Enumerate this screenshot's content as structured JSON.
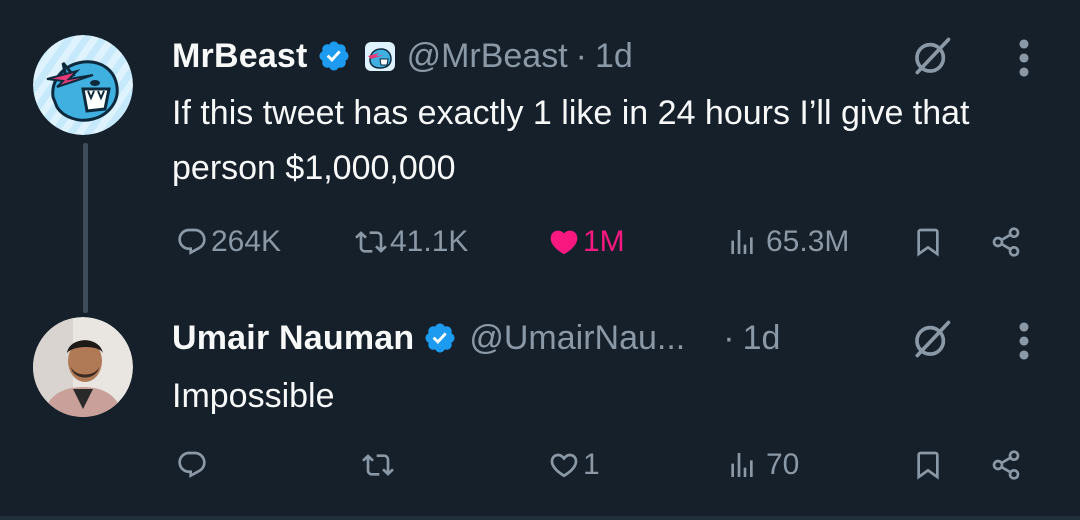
{
  "colors": {
    "background": "#15202b",
    "text_primary": "#f7f9f9",
    "text_secondary": "#8b98a5",
    "verified_blue": "#1d9bf0",
    "like_pink": "#f91880"
  },
  "tweets": [
    {
      "author": {
        "name": "MrBeast",
        "handle": "@MrBeast",
        "verified": true,
        "avatar": "mrbeast-panther-logo-avatar",
        "badge": "mrbeast-affiliate-logo"
      },
      "separator": "·",
      "time": "1d",
      "text": "If this tweet has exactly 1 like in 24 hours I’ll give that person $1,000,000",
      "actions": {
        "replies": "264K",
        "reposts": "41.1K",
        "likes": "1M",
        "liked": true,
        "views": "65.3M"
      },
      "icons": [
        "grok-icon",
        "more-icon",
        "reply-icon",
        "repost-icon",
        "like-icon",
        "views-icon",
        "bookmark-icon",
        "share-icon"
      ]
    },
    {
      "author": {
        "name": "Umair Nauman",
        "handle": "@UmairNau...",
        "verified": true,
        "avatar": "user-photo-avatar"
      },
      "separator": "·",
      "time": "1d",
      "text": "Impossible",
      "actions": {
        "replies": "",
        "reposts": "",
        "likes": "1",
        "liked": false,
        "views": "70"
      },
      "icons": [
        "grok-icon",
        "more-icon",
        "reply-icon",
        "repost-icon",
        "like-icon",
        "views-icon",
        "bookmark-icon",
        "share-icon"
      ]
    }
  ]
}
